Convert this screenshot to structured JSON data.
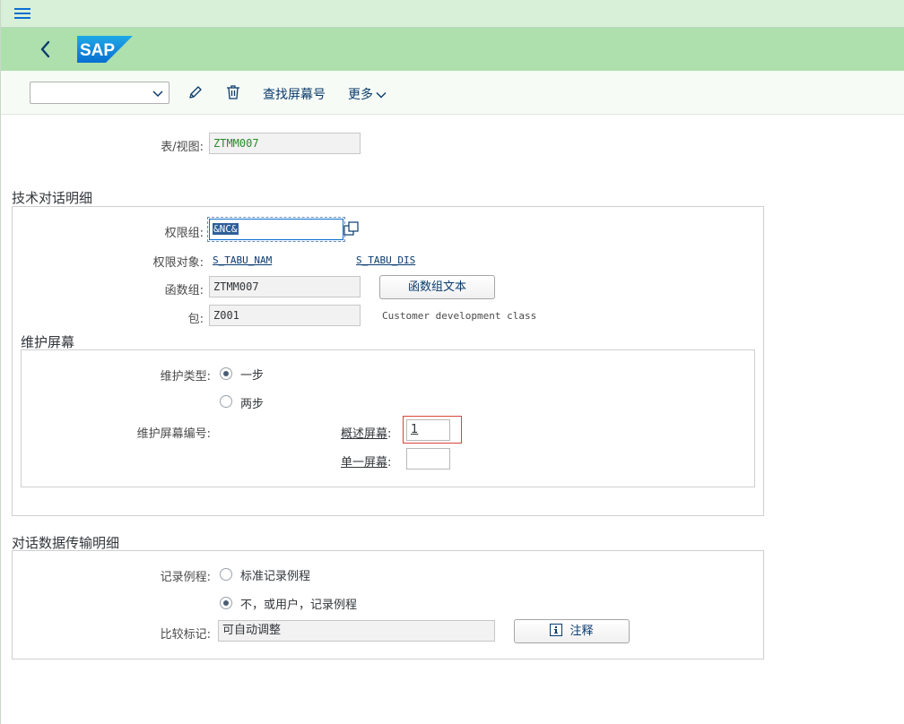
{
  "toolbar": {
    "select_value": "",
    "find_screen_label": "查找屏幕号",
    "more_label": "更多"
  },
  "header": {
    "table_view_label": "表/视图:",
    "table_view_value": "ZTMM007"
  },
  "tech_dialog": {
    "title": "技术对话明细",
    "auth_group_label": "权限组:",
    "auth_group_value": "&NC&",
    "auth_object_label": "权限对象:",
    "auth_object_1": "S_TABU_NAM",
    "auth_object_2": "S_TABU_DIS",
    "function_group_label": "函数组:",
    "function_group_value": "ZTMM007",
    "function_group_text_button": "函数组文本",
    "package_label": "包:",
    "package_value": "Z001",
    "package_desc": "Customer development class"
  },
  "maintenance_screen": {
    "title": "维护屏幕",
    "type_label": "维护类型:",
    "type_options": [
      "一步",
      "两步"
    ],
    "type_selected": 0,
    "screen_number_label": "维护屏幕编号:",
    "overview_label": "概述屏幕",
    "overview_value": "1",
    "single_label": "单一屏幕",
    "single_value": "",
    "colon": ":"
  },
  "transport": {
    "title": "对话数据传输明细",
    "routine_label": "记录例程:",
    "routine_options": [
      "标准记录例程",
      "不，或用户，记录例程"
    ],
    "routine_selected": 1,
    "compare_label": "比较标记:",
    "compare_value": "可自动调整",
    "note_button": "注释"
  },
  "colors": {
    "menubar": "#d8f0d8",
    "shell": "#aee0ae",
    "sap_blue": "#0a6ed1",
    "highlight_red": "#d9433b",
    "table_value_green": "#2a8a2a"
  }
}
